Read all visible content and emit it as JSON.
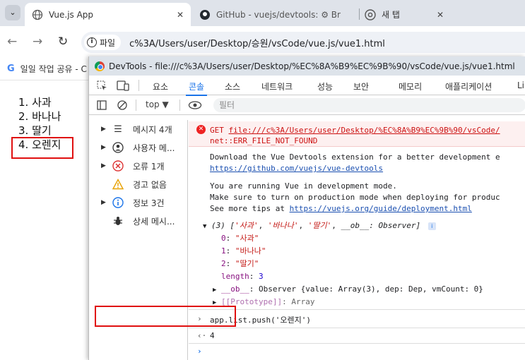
{
  "browser": {
    "tabs": [
      {
        "title": "Vue.js App",
        "active": true
      },
      {
        "title": "GitHub - vuejs/devtools: ⚙ Br"
      },
      {
        "title": "새 탭"
      }
    ],
    "chip_label": "파일",
    "url": "c%3A/Users/user/Desktop/승원/vsCode/vue.js/vue1.html",
    "bookmark": "일일 작업 공유 - C"
  },
  "page": {
    "items": [
      "1. 사과",
      "2. 바나나",
      "3. 딸기",
      "4. 오렌지"
    ]
  },
  "devtools": {
    "title": "DevTools - file:///c%3A/Users/user/Desktop/%EC%8A%B9%EC%9B%90/vsCode/vue.js/vue1.html",
    "tabs": [
      "요소",
      "콘솔",
      "소스",
      "네트워크",
      "성능",
      "보안",
      "메모리",
      "애플리케이션",
      "Li"
    ],
    "active_tab": "콘솔",
    "context": "top",
    "filter_placeholder": "필터",
    "sidebar": [
      {
        "label": "메시지 4개",
        "icon": "list-icon"
      },
      {
        "label": "사용자 메...",
        "icon": "user-icon"
      },
      {
        "label": "오류 1개",
        "icon": "error-icon"
      },
      {
        "label": "경고 없음",
        "icon": "warning-icon"
      },
      {
        "label": "정보 3건",
        "icon": "info-icon"
      },
      {
        "label": "상세 메시...",
        "icon": "bug-icon"
      }
    ],
    "console": {
      "error_get": "GET",
      "error_url": "file:///c%3A/Users/user/Desktop/%EC%8A%B9%EC%9B%90/vsCode/",
      "error_net": "net::ERR_FILE_NOT_FOUND",
      "msg1_line1": "Download the Vue Devtools extension for a better development e",
      "msg1_link": "https://github.com/vuejs/vue-devtools",
      "msg2_line1": "You are running Vue in development mode.",
      "msg2_line2": "Make sure to turn on production mode when deploying for produc",
      "msg2_line3_prefix": "See more tips at ",
      "msg2_link": "https://vuejs.org/guide/deployment.html",
      "array_summary_prefix": "(3) [",
      "array_summary_items": [
        "'사과'",
        "'바나나'",
        "'딸기'"
      ],
      "array_summary_ob": "__ob__",
      "array_summary_suffix": ": Observer]",
      "entries": [
        {
          "key": "0",
          "value": "\"사과\""
        },
        {
          "key": "1",
          "value": "\"바나나\""
        },
        {
          "key": "2",
          "value": "\"딸기\""
        }
      ],
      "length_key": "length",
      "length_value": "3",
      "ob_line_key": "__ob__",
      "ob_line_value": "Observer {value: Array(3), dep: Dep, vmCount: 0}",
      "proto_key": "[[Prototype]]",
      "proto_value": "Array",
      "command": "app.list.push('오렌지')",
      "result": "4"
    }
  }
}
